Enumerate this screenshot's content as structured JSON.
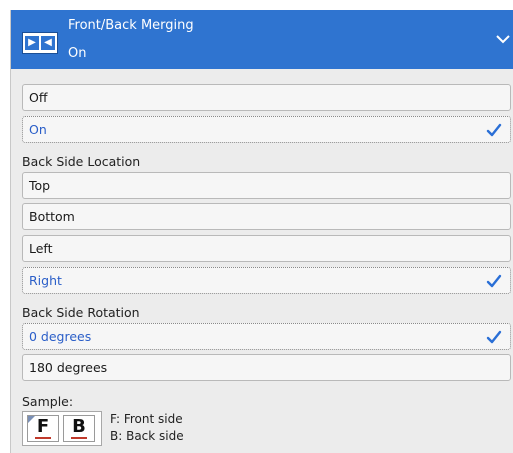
{
  "header": {
    "title": "Front/Back Merging",
    "value": "On",
    "icon": "front-back-merge-icon",
    "chevron": "chevron-down-icon",
    "color": "#2f74d0"
  },
  "merging": {
    "options": [
      {
        "label": "Off",
        "selected": false
      },
      {
        "label": "On",
        "selected": true
      }
    ]
  },
  "location": {
    "label": "Back Side Location",
    "options": [
      {
        "label": "Top",
        "selected": false
      },
      {
        "label": "Bottom",
        "selected": false
      },
      {
        "label": "Left",
        "selected": false
      },
      {
        "label": "Right",
        "selected": true
      }
    ]
  },
  "rotation": {
    "label": "Back Side Rotation",
    "options": [
      {
        "label": "0 degrees",
        "selected": true
      },
      {
        "label": "180 degrees",
        "selected": false
      }
    ]
  },
  "sample": {
    "label": "Sample:",
    "front_glyph": "F",
    "back_glyph": "B",
    "legend_front": "F: Front side",
    "legend_back": "B: Back side"
  },
  "colors": {
    "selected_text": "#2a5ec8",
    "checkmark": "#2a6fd6"
  }
}
